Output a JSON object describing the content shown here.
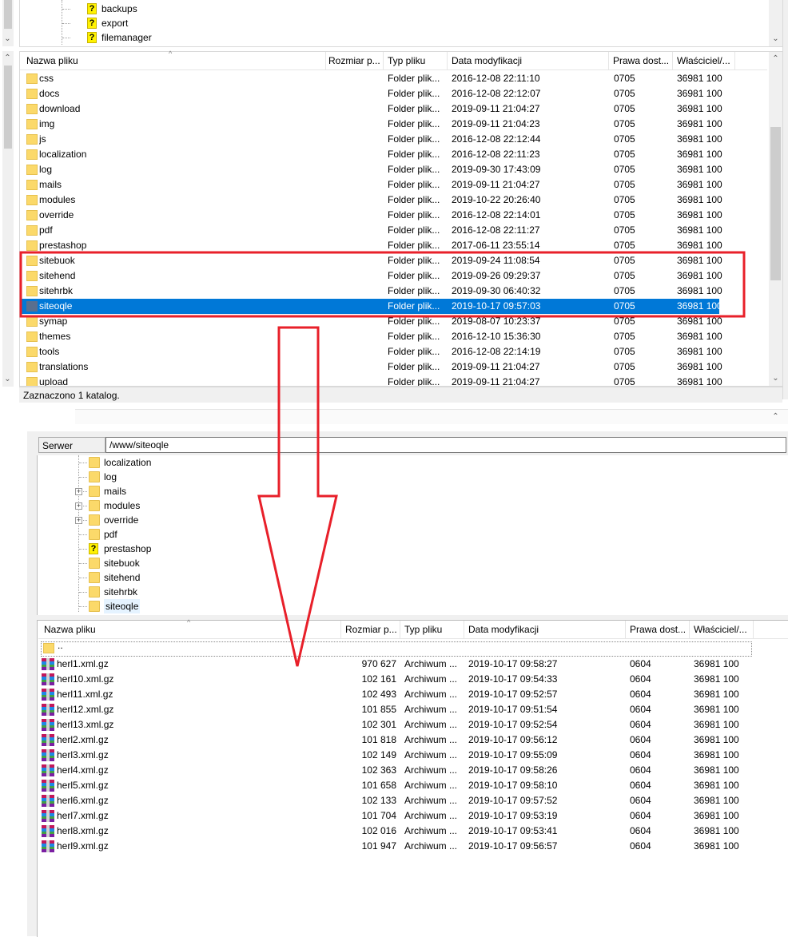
{
  "top_tree": {
    "items": [
      {
        "label": "backups",
        "icon": "question-folder-icon"
      },
      {
        "label": "export",
        "icon": "question-folder-icon"
      },
      {
        "label": "filemanager",
        "icon": "question-folder-icon"
      }
    ]
  },
  "top_list": {
    "columns": [
      "Nazwa pliku",
      "Rozmiar p...",
      "Typ pliku",
      "Data modyfikacji",
      "Prawa dost...",
      "Właściciel/..."
    ],
    "rows": [
      {
        "name": "css",
        "type": "Folder plik...",
        "modified": "2016-12-08 22:11:10",
        "perms": "0705",
        "owner": "36981 100"
      },
      {
        "name": "docs",
        "type": "Folder plik...",
        "modified": "2016-12-08 22:12:07",
        "perms": "0705",
        "owner": "36981 100"
      },
      {
        "name": "download",
        "type": "Folder plik...",
        "modified": "2019-09-11 21:04:27",
        "perms": "0705",
        "owner": "36981 100"
      },
      {
        "name": "img",
        "type": "Folder plik...",
        "modified": "2019-09-11 21:04:23",
        "perms": "0705",
        "owner": "36981 100"
      },
      {
        "name": "js",
        "type": "Folder plik...",
        "modified": "2016-12-08 22:12:44",
        "perms": "0705",
        "owner": "36981 100"
      },
      {
        "name": "localization",
        "type": "Folder plik...",
        "modified": "2016-12-08 22:11:23",
        "perms": "0705",
        "owner": "36981 100"
      },
      {
        "name": "log",
        "type": "Folder plik...",
        "modified": "2019-09-30 17:43:09",
        "perms": "0705",
        "owner": "36981 100"
      },
      {
        "name": "mails",
        "type": "Folder plik...",
        "modified": "2019-09-11 21:04:27",
        "perms": "0705",
        "owner": "36981 100"
      },
      {
        "name": "modules",
        "type": "Folder plik...",
        "modified": "2019-10-22 20:26:40",
        "perms": "0705",
        "owner": "36981 100"
      },
      {
        "name": "override",
        "type": "Folder plik...",
        "modified": "2016-12-08 22:14:01",
        "perms": "0705",
        "owner": "36981 100"
      },
      {
        "name": "pdf",
        "type": "Folder plik...",
        "modified": "2016-12-08 22:11:27",
        "perms": "0705",
        "owner": "36981 100"
      },
      {
        "name": "prestashop",
        "type": "Folder plik...",
        "modified": "2017-06-11 23:55:14",
        "perms": "0705",
        "owner": "36981 100"
      },
      {
        "name": "sitebuok",
        "type": "Folder plik...",
        "modified": "2019-09-24 11:08:54",
        "perms": "0705",
        "owner": "36981 100"
      },
      {
        "name": "sitehend",
        "type": "Folder plik...",
        "modified": "2019-09-26 09:29:37",
        "perms": "0705",
        "owner": "36981 100"
      },
      {
        "name": "sitehrbk",
        "type": "Folder plik...",
        "modified": "2019-09-30 06:40:32",
        "perms": "0705",
        "owner": "36981 100"
      },
      {
        "name": "siteoqle",
        "type": "Folder plik...",
        "modified": "2019-10-17 09:57:03",
        "perms": "0705",
        "owner": "36981 100",
        "selected": true
      },
      {
        "name": "symap",
        "type": "Folder plik...",
        "modified": "2019-08-07 10:23:37",
        "perms": "0705",
        "owner": "36981 100"
      },
      {
        "name": "themes",
        "type": "Folder plik...",
        "modified": "2016-12-10 15:36:30",
        "perms": "0705",
        "owner": "36981 100"
      },
      {
        "name": "tools",
        "type": "Folder plik...",
        "modified": "2016-12-08 22:14:19",
        "perms": "0705",
        "owner": "36981 100"
      },
      {
        "name": "translations",
        "type": "Folder plik...",
        "modified": "2019-09-11 21:04:27",
        "perms": "0705",
        "owner": "36981 100"
      },
      {
        "name": "upload",
        "type": "Folder plik...",
        "modified": "2019-09-11 21:04:27",
        "perms": "0705",
        "owner": "36981 100"
      }
    ],
    "status": "Zaznaczono 1 katalog."
  },
  "remote": {
    "label": "Serwer zdalny:",
    "path": "/www/siteoqle"
  },
  "bottom_tree": {
    "items": [
      {
        "label": "localization",
        "icon": "folder-icon",
        "expander": false
      },
      {
        "label": "log",
        "icon": "folder-icon",
        "expander": false
      },
      {
        "label": "mails",
        "icon": "folder-icon",
        "expander": true
      },
      {
        "label": "modules",
        "icon": "folder-icon",
        "expander": true
      },
      {
        "label": "override",
        "icon": "folder-icon",
        "expander": true
      },
      {
        "label": "pdf",
        "icon": "folder-icon",
        "expander": false
      },
      {
        "label": "prestashop",
        "icon": "question-folder-icon",
        "expander": false
      },
      {
        "label": "sitebuok",
        "icon": "folder-icon",
        "expander": false
      },
      {
        "label": "sitehend",
        "icon": "folder-icon",
        "expander": false
      },
      {
        "label": "sitehrbk",
        "icon": "folder-icon",
        "expander": false
      },
      {
        "label": "siteoqle",
        "icon": "folder-icon",
        "expander": false,
        "selected": true
      }
    ]
  },
  "bottom_list": {
    "columns": [
      "Nazwa pliku",
      "Rozmiar p...",
      "Typ pliku",
      "Data modyfikacji",
      "Prawa dost...",
      "Właściciel/..."
    ],
    "parent_row": "..",
    "rows": [
      {
        "name": "herl1.xml.gz",
        "size": "970 627",
        "type": "Archiwum ...",
        "modified": "2019-10-17 09:58:27",
        "perms": "0604",
        "owner": "36981 100"
      },
      {
        "name": "herl10.xml.gz",
        "size": "102 161",
        "type": "Archiwum ...",
        "modified": "2019-10-17 09:54:33",
        "perms": "0604",
        "owner": "36981 100"
      },
      {
        "name": "herl11.xml.gz",
        "size": "102 493",
        "type": "Archiwum ...",
        "modified": "2019-10-17 09:52:57",
        "perms": "0604",
        "owner": "36981 100"
      },
      {
        "name": "herl12.xml.gz",
        "size": "101 855",
        "type": "Archiwum ...",
        "modified": "2019-10-17 09:51:54",
        "perms": "0604",
        "owner": "36981 100"
      },
      {
        "name": "herl13.xml.gz",
        "size": "102 301",
        "type": "Archiwum ...",
        "modified": "2019-10-17 09:52:54",
        "perms": "0604",
        "owner": "36981 100"
      },
      {
        "name": "herl2.xml.gz",
        "size": "101 818",
        "type": "Archiwum ...",
        "modified": "2019-10-17 09:56:12",
        "perms": "0604",
        "owner": "36981 100"
      },
      {
        "name": "herl3.xml.gz",
        "size": "102 149",
        "type": "Archiwum ...",
        "modified": "2019-10-17 09:55:09",
        "perms": "0604",
        "owner": "36981 100"
      },
      {
        "name": "herl4.xml.gz",
        "size": "102 363",
        "type": "Archiwum ...",
        "modified": "2019-10-17 09:58:26",
        "perms": "0604",
        "owner": "36981 100"
      },
      {
        "name": "herl5.xml.gz",
        "size": "101 658",
        "type": "Archiwum ...",
        "modified": "2019-10-17 09:58:10",
        "perms": "0604",
        "owner": "36981 100"
      },
      {
        "name": "herl6.xml.gz",
        "size": "102 133",
        "type": "Archiwum ...",
        "modified": "2019-10-17 09:57:52",
        "perms": "0604",
        "owner": "36981 100"
      },
      {
        "name": "herl7.xml.gz",
        "size": "101 704",
        "type": "Archiwum ...",
        "modified": "2019-10-17 09:53:19",
        "perms": "0604",
        "owner": "36981 100"
      },
      {
        "name": "herl8.xml.gz",
        "size": "102 016",
        "type": "Archiwum ...",
        "modified": "2019-10-17 09:53:41",
        "perms": "0604",
        "owner": "36981 100"
      },
      {
        "name": "herl9.xml.gz",
        "size": "101 947",
        "type": "Archiwum ...",
        "modified": "2019-10-17 09:56:57",
        "perms": "0604",
        "owner": "36981 100"
      }
    ]
  },
  "annotation": {
    "highlight_color": "#e8202a",
    "arrow_color": "#e8202a",
    "selection_color": "#0078d7"
  }
}
